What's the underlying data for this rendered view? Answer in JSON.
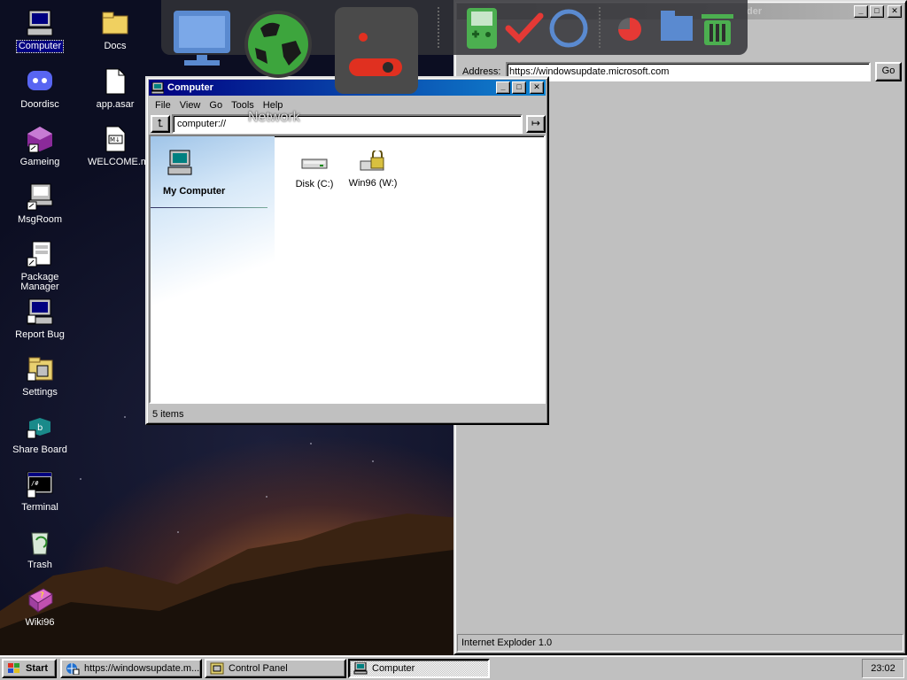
{
  "desktop": {
    "icons_left": [
      {
        "label": "Computer",
        "icon": "computer-icon"
      },
      {
        "label": "Doordisc",
        "icon": "discord-icon"
      },
      {
        "label": "Gameing",
        "icon": "cube-icon"
      },
      {
        "label": "MsgRoom",
        "icon": "msgroom-icon"
      },
      {
        "label": "Package Manager",
        "icon": "package-icon"
      },
      {
        "label": "Report Bug",
        "icon": "report-bug-icon"
      },
      {
        "label": "Settings",
        "icon": "settings-icon"
      },
      {
        "label": "Share Board",
        "icon": "share-board-icon"
      },
      {
        "label": "Terminal",
        "icon": "terminal-icon"
      },
      {
        "label": "Trash",
        "icon": "trash-icon"
      },
      {
        "label": "Wiki96",
        "icon": "wiki-book-icon"
      }
    ],
    "icons_right": [
      {
        "label": "Docs",
        "icon": "folder-icon"
      },
      {
        "label": "app.asar",
        "icon": "file-icon"
      },
      {
        "label": "WELCOME.md",
        "icon": "markdown-file-icon"
      }
    ]
  },
  "dock": {
    "hover_label": "Network",
    "items": [
      "monitor-icon",
      "globe-icon",
      "toggle-icon",
      "gameboy-icon",
      "checkmark-icon",
      "circle-icon",
      "pie-icon",
      "folder-icon",
      "trash-icon"
    ]
  },
  "browser": {
    "title_fragment": "der",
    "address_label": "Address:",
    "address_value": "https://windowsupdate.microsoft.com",
    "go_label": "Go",
    "status": "Internet Exploder 1.0"
  },
  "explorer": {
    "title": "Computer",
    "menu": [
      "File",
      "View",
      "Go",
      "Tools",
      "Help"
    ],
    "path": "computer://",
    "sidebar_title": "My Computer",
    "items": [
      {
        "label": "Disk (C:)",
        "icon": "disk-drive-icon"
      },
      {
        "label": "Win96 (W:)",
        "icon": "locked-drive-icon"
      }
    ],
    "status": "5 items"
  },
  "taskbar": {
    "start_label": "Start",
    "tasks": [
      {
        "label": "https://windowsupdate.m...",
        "icon": "browser-icon"
      },
      {
        "label": "Control Panel",
        "icon": "control-panel-icon"
      },
      {
        "label": "Computer",
        "icon": "computer-icon"
      }
    ],
    "clock": "23:02"
  }
}
